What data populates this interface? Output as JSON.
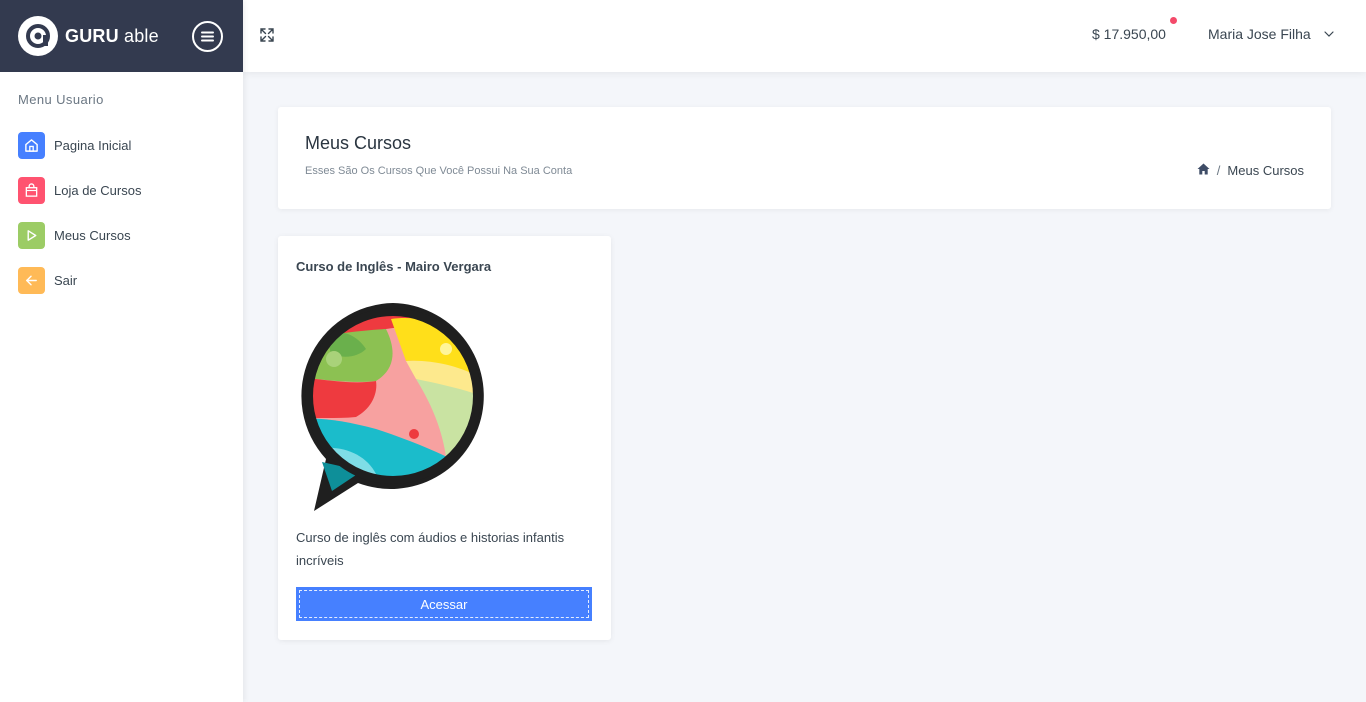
{
  "brand": {
    "name_bold": "GURU",
    "name_light": "able"
  },
  "sidebar": {
    "caption": "Menu Usuario",
    "items": [
      {
        "label": "Pagina Inicial",
        "icon": "home-icon",
        "color": "#4680ff"
      },
      {
        "label": "Loja de Cursos",
        "icon": "shopping-bag-icon",
        "color": "#ff5370"
      },
      {
        "label": "Meus Cursos",
        "icon": "play-icon",
        "color": "#9ccc65"
      },
      {
        "label": "Sair",
        "icon": "arrow-left-icon",
        "color": "#ffba57"
      }
    ]
  },
  "header": {
    "balance": "$  17.950,00",
    "user_name": "Maria Jose Filha"
  },
  "page": {
    "title": "Meus Cursos",
    "subtitle": "Esses São Os Cursos Que Você Possui Na Sua Conta",
    "breadcrumb": {
      "separator": "/",
      "current": "Meus Cursos"
    }
  },
  "courses": [
    {
      "title": "Curso de Inglês - Mairo Vergara",
      "description": "Curso de inglês com áudios e historias infantis incríveis",
      "button_label": "Acessar"
    }
  ],
  "colors": {
    "primary": "#4680ff",
    "sidebar_header": "#333a4f",
    "notification": "#f44a6a"
  }
}
